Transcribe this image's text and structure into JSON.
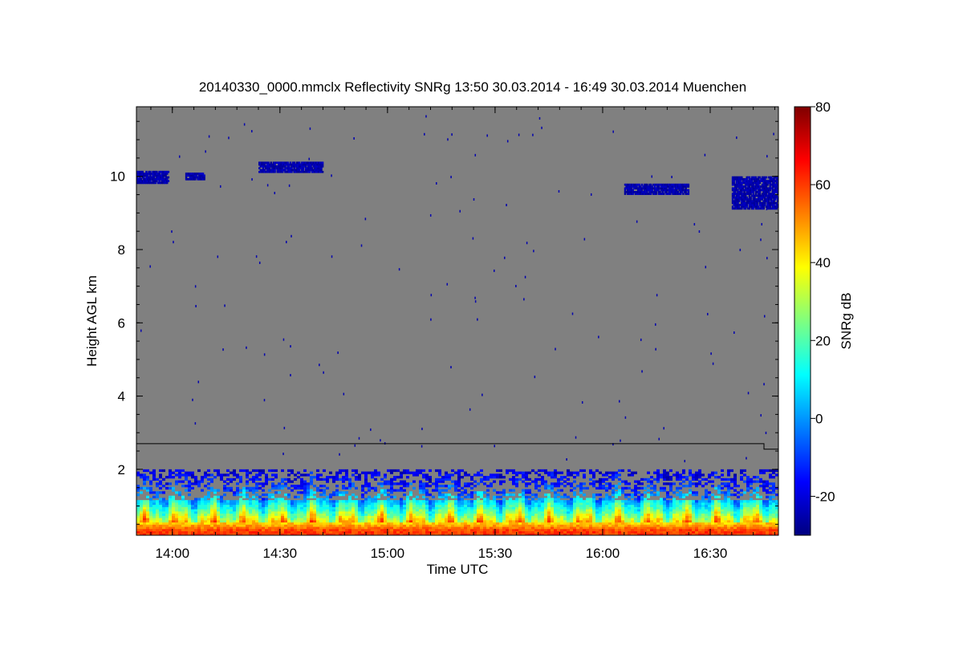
{
  "chart_data": {
    "type": "heatmap",
    "title": "20140330_0000.mmclx Reflectivity SNRg   13:50 30.03.2014 - 16:49 30.03.2014 Muenchen",
    "xlabel": "Time UTC",
    "ylabel": "Height AGL km",
    "colorbar_label": "SNRg dB",
    "x_range": [
      "13:50",
      "16:49"
    ],
    "xlim_hours": [
      13.833,
      16.817
    ],
    "ylim_km": [
      0.2,
      11.9
    ],
    "colorbar_range": [
      -30,
      80
    ],
    "x_ticks": [
      "14:00",
      "14:30",
      "15:00",
      "15:30",
      "16:00",
      "16:30"
    ],
    "x_tick_hours": [
      14.0,
      14.5,
      15.0,
      15.5,
      16.0,
      16.5
    ],
    "y_ticks": [
      "2",
      "4",
      "6",
      "8",
      "10"
    ],
    "y_tick_values": [
      2,
      4,
      6,
      8,
      10
    ],
    "colorbar_ticks": [
      "-20",
      "0",
      "20",
      "40",
      "60",
      "80"
    ],
    "colorbar_tick_values": [
      -20,
      0,
      20,
      40,
      60,
      80
    ],
    "background_color": "#808080",
    "colormap": [
      "#00007f",
      "#0000ff",
      "#007fff",
      "#00ffff",
      "#7fff7f",
      "#ffff00",
      "#ff7f00",
      "#ff0000",
      "#7f0000"
    ],
    "overlay_line": [
      {
        "time": 13.833,
        "height_km": 2.7
      },
      {
        "time": 16.75,
        "height_km": 2.7
      },
      {
        "time": 16.75,
        "height_km": 2.55
      },
      {
        "time": 16.817,
        "height_km": 2.55
      }
    ],
    "cloud_layers": [
      {
        "time_start": 13.833,
        "time_end": 13.98,
        "height_bottom_km": 9.8,
        "height_top_km": 10.15,
        "snr_db": -25
      },
      {
        "time_start": 14.06,
        "time_end": 14.15,
        "height_bottom_km": 9.9,
        "height_top_km": 10.1,
        "snr_db": -25
      },
      {
        "time_start": 14.4,
        "time_end": 14.7,
        "height_bottom_km": 10.1,
        "height_top_km": 10.4,
        "snr_db": -25
      },
      {
        "time_start": 16.1,
        "time_end": 16.4,
        "height_bottom_km": 9.5,
        "height_top_km": 9.8,
        "snr_db": -25
      },
      {
        "time_start": 16.6,
        "time_end": 16.817,
        "height_bottom_km": 9.1,
        "height_top_km": 10.0,
        "snr_db": -25
      }
    ],
    "boundary_layer": {
      "height_top_km": 2.0,
      "profile": [
        {
          "height_km": 0.3,
          "snr_db": 60
        },
        {
          "height_km": 0.45,
          "snr_db": 48
        },
        {
          "height_km": 0.6,
          "snr_db": 38
        },
        {
          "height_km": 0.85,
          "snr_db": 20
        },
        {
          "height_km": 1.1,
          "snr_db": 8
        },
        {
          "height_km": 1.4,
          "snr_db": -10
        },
        {
          "height_km": 2.0,
          "snr_db": -22
        }
      ]
    }
  }
}
